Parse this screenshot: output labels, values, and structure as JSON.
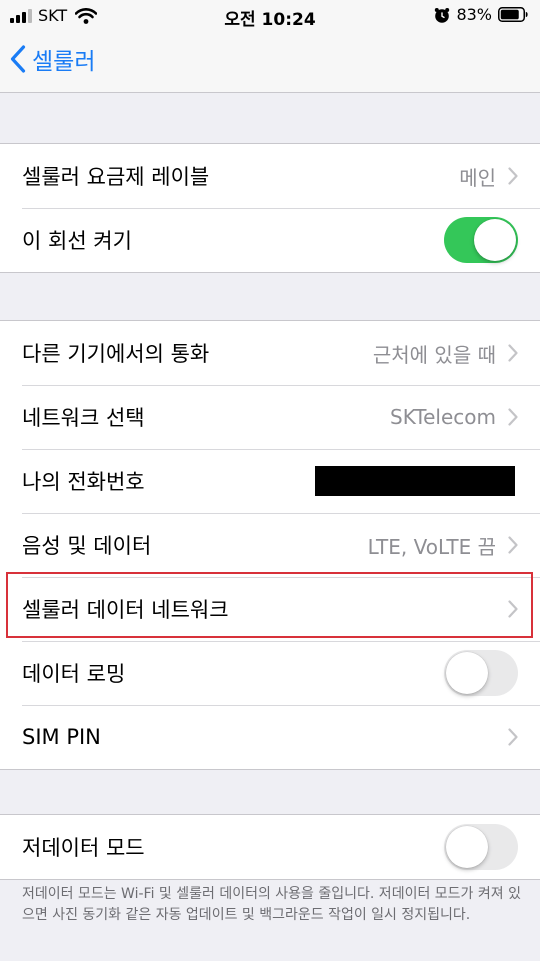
{
  "status_bar": {
    "carrier": "SKT",
    "time": "오전 10:24",
    "battery_percent": "83%"
  },
  "nav": {
    "back_label": "셀룰러"
  },
  "groups": [
    {
      "rows": [
        {
          "label": "셀룰러 요금제 레이블",
          "value": "메인",
          "type": "disclosure"
        },
        {
          "label": "이 회선 켜기",
          "type": "toggle",
          "on": true
        }
      ]
    },
    {
      "rows": [
        {
          "label": "다른 기기에서의 통화",
          "value": "근처에 있을 때",
          "type": "disclosure"
        },
        {
          "label": "네트워크 선택",
          "value": "SKTelecom",
          "type": "disclosure"
        },
        {
          "label": "나의 전화번호",
          "type": "redacted"
        },
        {
          "label": "음성 및 데이터",
          "value": "LTE, VoLTE 끔",
          "type": "disclosure"
        },
        {
          "label": "셀룰러 데이터 네트워크",
          "type": "disclosure",
          "highlighted": true
        },
        {
          "label": "데이터 로밍",
          "type": "toggle",
          "on": false
        },
        {
          "label": "SIM PIN",
          "type": "disclosure"
        }
      ]
    },
    {
      "rows": [
        {
          "label": "저데이터 모드",
          "type": "toggle",
          "on": false
        }
      ]
    }
  ],
  "footnote": "저데이터 모드는 Wi-Fi 및 셀룰러 데이터의 사용을 줄입니다. 저데이터 모드가 켜져 있으면 사진 동기화 같은 자동 업데이트 및 백그라운드 작업이 일시 정지됩니다.",
  "colors": {
    "accent": "#1a7cf5",
    "toggle_on": "#34c759",
    "highlight": "#d8313a"
  }
}
